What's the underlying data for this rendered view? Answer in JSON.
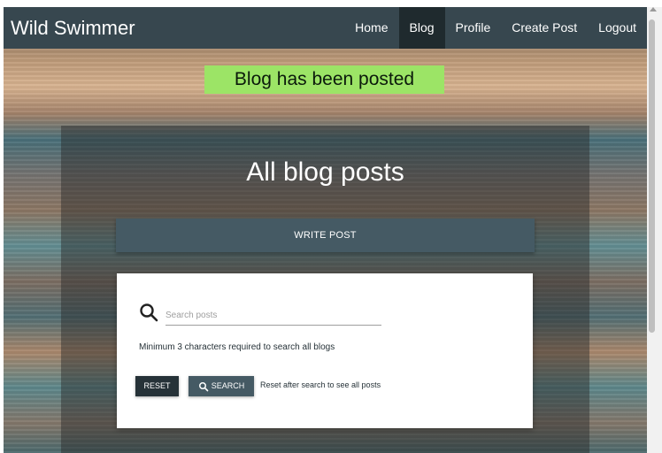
{
  "nav": {
    "brand": "Wild Swimmer",
    "links": [
      "Home",
      "Blog",
      "Profile",
      "Create Post",
      "Logout"
    ],
    "active": "Blog"
  },
  "flash": {
    "message": "Blog has been posted"
  },
  "main": {
    "title": "All blog posts",
    "write_button": "WRITE POST",
    "search": {
      "placeholder": "Search posts",
      "hint": "Minimum 3 characters required to search all blogs",
      "reset_label": "RESET",
      "search_label": "SEARCH",
      "reset_note": "Reset after search to see all posts"
    }
  },
  "colors": {
    "navbar": "#37474f",
    "nav_active": "#1f2a2e",
    "flash_bg": "#9ce466",
    "write_button": "#455a64",
    "reset_button": "#263238",
    "search_button": "#455a64"
  },
  "icons": {
    "search": "search-icon"
  }
}
